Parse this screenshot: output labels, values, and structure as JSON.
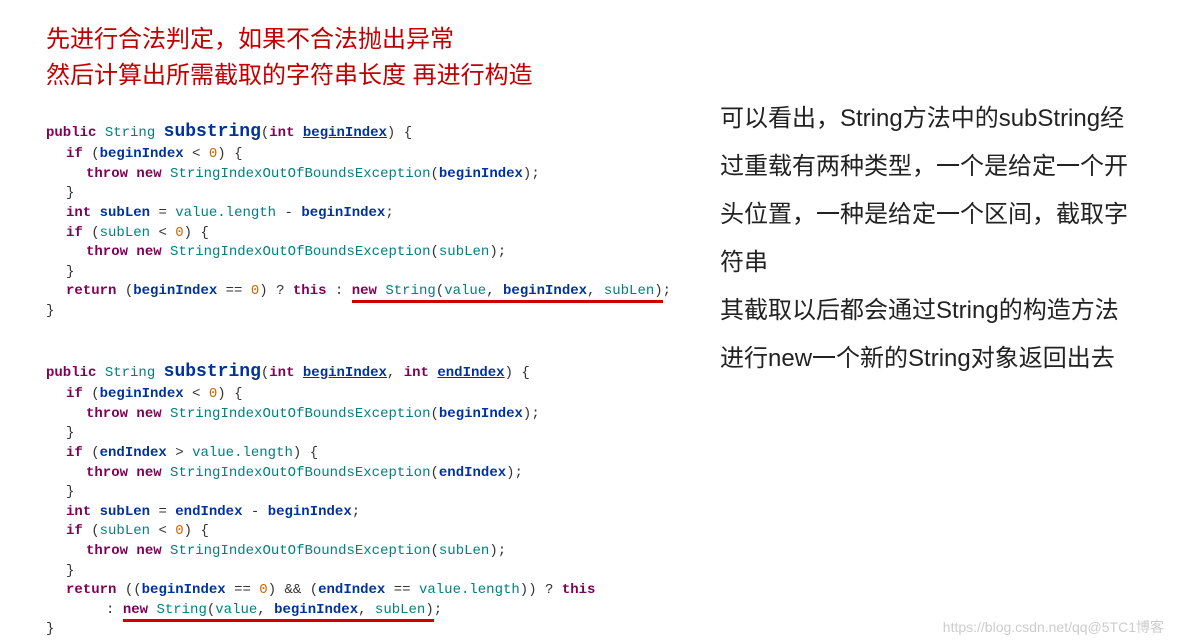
{
  "header": {
    "line1": "先进行合法判定，如果不合法抛出异常",
    "line2": "然后计算出所需截取的字符串长度 再进行构造"
  },
  "right": {
    "p1": "可以看出，String方法中的subString经过重载有两种类型，一个是给定一个开头位置，一种是给定一个区间，截取字符串",
    "p2": "其截取以后都会通过String的构造方法进行new一个新的String对象返回出去"
  },
  "code1": {
    "kw_public": "public",
    "type_string": "String",
    "method": "substring",
    "kw_int": "int",
    "p_beginIndex": "beginIndex",
    "kw_if": "if",
    "zero": "0",
    "kw_throw": "throw",
    "kw_new": "new",
    "exc": "StringIndexOutOfBoundsException",
    "subLen": "subLen",
    "value_length": "value.length",
    "kw_return": "return",
    "kw_this": "this",
    "value": "value"
  },
  "code2": {
    "kw_public": "public",
    "type_string": "String",
    "method": "substring",
    "kw_int": "int",
    "p_beginIndex": "beginIndex",
    "p_endIndex": "endIndex",
    "kw_if": "if",
    "zero": "0",
    "kw_throw": "throw",
    "kw_new": "new",
    "exc": "StringIndexOutOfBoundsException",
    "value_length": "value.length",
    "subLen": "subLen",
    "kw_return": "return",
    "kw_this": "this",
    "value": "value",
    "amp": "&&"
  },
  "watermark": "https://blog.csdn.net/qq@5TC1博客"
}
